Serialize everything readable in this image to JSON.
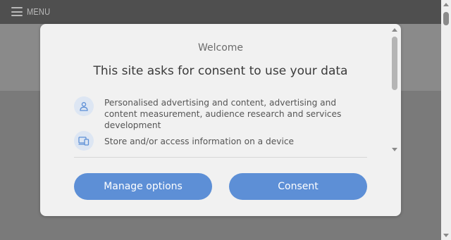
{
  "page": {
    "menu_label": "MENU"
  },
  "dialog": {
    "welcome": "Welcome",
    "title": "This site asks for consent to use your data",
    "purposes": [
      {
        "icon": "person-icon",
        "text": "Personalised advertising and content, advertising and content measurement, audience research and services development"
      },
      {
        "icon": "devices-icon",
        "text": "Store and/or access information on a device"
      }
    ],
    "buttons": {
      "manage": "Manage options",
      "consent": "Consent"
    }
  },
  "colors": {
    "accent": "#5d8fd6",
    "icon_bg": "#dde6f3",
    "dialog_bg": "#f1f1f1"
  }
}
